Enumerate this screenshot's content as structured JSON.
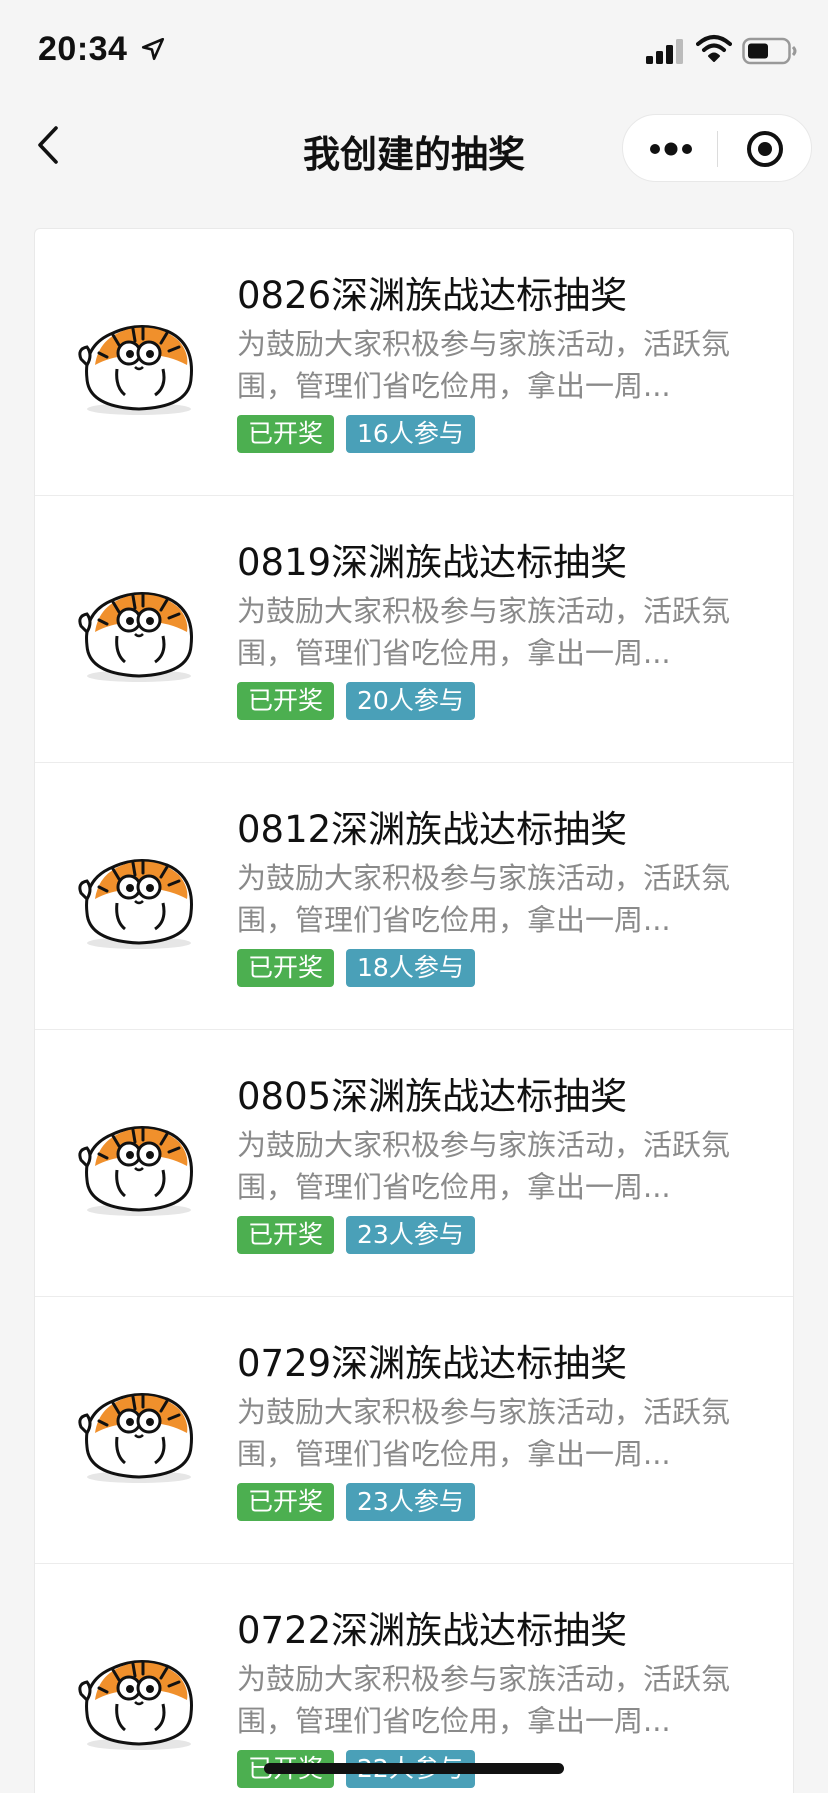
{
  "status_bar": {
    "time": "20:34",
    "icons": [
      "location-arrow-icon",
      "signal-icon",
      "wifi-icon",
      "battery-icon"
    ]
  },
  "nav": {
    "title": "我创建的抽奖",
    "icons": [
      "back-icon",
      "more-icon",
      "close-icon"
    ]
  },
  "colors": {
    "status_tag": "#4caf50",
    "count_tag": "#4aa0b8",
    "background": "#f5f5f5"
  },
  "lotteries": [
    {
      "title": "0826深渊族战达标抽奖",
      "desc": "为鼓励大家积极参与家族活动，活跃氛围，管理们省吃俭用，拿出一周...",
      "status": "已开奖",
      "participants": "16人参与"
    },
    {
      "title": "0819深渊族战达标抽奖",
      "desc": "为鼓励大家积极参与家族活动，活跃氛围，管理们省吃俭用，拿出一周...",
      "status": "已开奖",
      "participants": "20人参与"
    },
    {
      "title": "0812深渊族战达标抽奖",
      "desc": "为鼓励大家积极参与家族活动，活跃氛围，管理们省吃俭用，拿出一周...",
      "status": "已开奖",
      "participants": "18人参与"
    },
    {
      "title": "0805深渊族战达标抽奖",
      "desc": "为鼓励大家积极参与家族活动，活跃氛围，管理们省吃俭用，拿出一周...",
      "status": "已开奖",
      "participants": "23人参与"
    },
    {
      "title": "0729深渊族战达标抽奖",
      "desc": "为鼓励大家积极参与家族活动，活跃氛围，管理们省吃俭用，拿出一周...",
      "status": "已开奖",
      "participants": "23人参与"
    },
    {
      "title": "0722深渊族战达标抽奖",
      "desc": "为鼓励大家积极参与家族活动，活跃氛围，管理们省吃俭用，拿出一周...",
      "status": "已开奖",
      "participants": "22人参与"
    }
  ]
}
